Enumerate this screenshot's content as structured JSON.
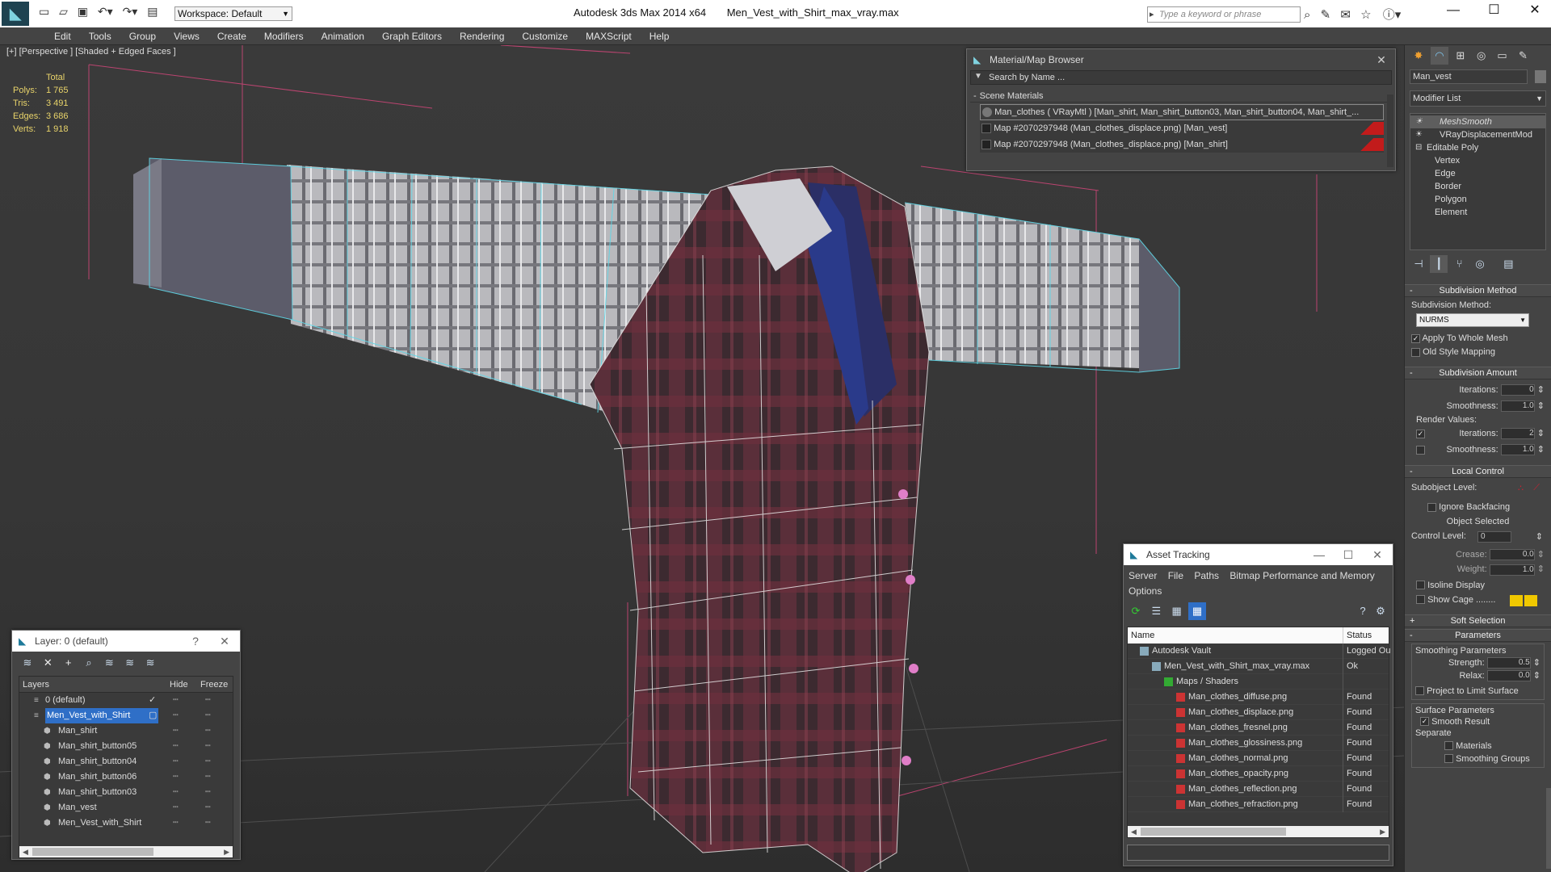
{
  "titlebar": {
    "app_title": "Autodesk 3ds Max  2014 x64",
    "file_title": "Men_Vest_with_Shirt_max_vray.max",
    "workspace": "Workspace: Default",
    "search_placeholder": "Type a keyword or phrase"
  },
  "menu": [
    "Edit",
    "Tools",
    "Group",
    "Views",
    "Create",
    "Modifiers",
    "Animation",
    "Graph Editors",
    "Rendering",
    "Customize",
    "MAXScript",
    "Help"
  ],
  "viewport": {
    "label": "[+] [Perspective ] [Shaded + Edged Faces ]",
    "stats_header": "Total",
    "stats": [
      {
        "k": "Polys:",
        "v": "1 765"
      },
      {
        "k": "Tris:",
        "v": "3 491"
      },
      {
        "k": "Edges:",
        "v": "3 686"
      },
      {
        "k": "Verts:",
        "v": "1 918"
      }
    ]
  },
  "material_browser": {
    "title": "Material/Map Browser",
    "search_placeholder": "Search by Name ...",
    "group": "Scene Materials",
    "items": [
      "Man_clothes  ( VRayMtl ) [Man_shirt, Man_shirt_button03, Man_shirt_button04, Man_shirt_...",
      "Map #2070297948 (Man_clothes_displace.png) [Man_vest]",
      "Map #2070297948 (Man_clothes_displace.png) [Man_shirt]"
    ]
  },
  "asset_tracking": {
    "title": "Asset Tracking",
    "menu": [
      "Server",
      "File",
      "Paths",
      "Bitmap Performance and Memory",
      "Options"
    ],
    "columns": [
      "Name",
      "Status"
    ],
    "rows": [
      {
        "name": "Autodesk Vault",
        "status": "Logged Ou",
        "level": 1
      },
      {
        "name": "Men_Vest_with_Shirt_max_vray.max",
        "status": "Ok",
        "level": 2
      },
      {
        "name": "Maps / Shaders",
        "status": "",
        "level": 3
      },
      {
        "name": "Man_clothes_diffuse.png",
        "status": "Found",
        "level": 4
      },
      {
        "name": "Man_clothes_displace.png",
        "status": "Found",
        "level": 4
      },
      {
        "name": "Man_clothes_fresnel.png",
        "status": "Found",
        "level": 4
      },
      {
        "name": "Man_clothes_glossiness.png",
        "status": "Found",
        "level": 4
      },
      {
        "name": "Man_clothes_normal.png",
        "status": "Found",
        "level": 4
      },
      {
        "name": "Man_clothes_opacity.png",
        "status": "Found",
        "level": 4
      },
      {
        "name": "Man_clothes_reflection.png",
        "status": "Found",
        "level": 4
      },
      {
        "name": "Man_clothes_refraction.png",
        "status": "Found",
        "level": 4
      }
    ]
  },
  "layer_window": {
    "title": "Layer: 0 (default)",
    "columns": [
      "Layers",
      "Hide",
      "Freeze"
    ],
    "rows": [
      {
        "name": "0 (default)",
        "level": 1,
        "selected": false
      },
      {
        "name": "Men_Vest_with_Shirt",
        "level": 1,
        "selected": true
      },
      {
        "name": "Man_shirt",
        "level": 2,
        "selected": false
      },
      {
        "name": "Man_shirt_button05",
        "level": 2,
        "selected": false
      },
      {
        "name": "Man_shirt_button04",
        "level": 2,
        "selected": false
      },
      {
        "name": "Man_shirt_button06",
        "level": 2,
        "selected": false
      },
      {
        "name": "Man_shirt_button03",
        "level": 2,
        "selected": false
      },
      {
        "name": "Man_vest",
        "level": 2,
        "selected": false
      },
      {
        "name": "Men_Vest_with_Shirt",
        "level": 2,
        "selected": false
      }
    ]
  },
  "command_panel": {
    "object_name": "Man_vest",
    "modifier_list": "Modifier List",
    "stack": [
      {
        "name": "MeshSmooth",
        "level": 1,
        "active": true
      },
      {
        "name": "VRayDisplacementMod",
        "level": 1,
        "active": false
      },
      {
        "name": "Editable Poly",
        "level": 1,
        "active": false
      },
      {
        "name": "Vertex",
        "level": 2,
        "active": false
      },
      {
        "name": "Edge",
        "level": 2,
        "active": false
      },
      {
        "name": "Border",
        "level": 2,
        "active": false
      },
      {
        "name": "Polygon",
        "level": 2,
        "active": false
      },
      {
        "name": "Element",
        "level": 2,
        "active": false
      }
    ],
    "subdiv_method_title": "Subdivision Method",
    "subdiv_method_label": "Subdivision Method:",
    "subdiv_method_value": "NURMS",
    "apply_whole_mesh": "Apply To Whole Mesh",
    "old_style_mapping": "Old Style Mapping",
    "subdiv_amount_title": "Subdivision Amount",
    "iterations_label": "Iterations:",
    "iterations_value": "0",
    "smoothness_label": "Smoothness:",
    "smoothness_value": "1.0",
    "render_values_label": "Render Values:",
    "render_iterations_value": "2",
    "render_smoothness_value": "1.0",
    "local_control_title": "Local Control",
    "subobject_level_label": "Subobject Level:",
    "ignore_backfacing": "Ignore Backfacing",
    "object_selected": "Object Selected",
    "control_level_label": "Control Level:",
    "control_level_value": "0",
    "crease_label": "Crease:",
    "crease_value": "0.0",
    "weight_label": "Weight:",
    "weight_value": "1.0",
    "isoline_display": "Isoline Display",
    "show_cage": "Show Cage ........",
    "soft_selection_title": "Soft Selection",
    "parameters_title": "Parameters",
    "smoothing_params_label": "Smoothing Parameters",
    "strength_label": "Strength:",
    "strength_value": "0.5",
    "relax_label": "Relax:",
    "relax_value": "0.0",
    "project_limit": "Project to Limit Surface",
    "surface_params_label": "Surface Parameters",
    "smooth_result": "Smooth Result",
    "separate_label": "Separate",
    "materials": "Materials",
    "smoothing_groups": "Smoothing Groups"
  },
  "colors": {
    "stats_yellow": "#e8d36a",
    "selection_blue": "#2f6fc7",
    "wire_cyan": "#5fd8e8",
    "vest_red": "#6a2a36",
    "accent_red": "#c21b1b",
    "cage_yellow": "#f0c800"
  }
}
